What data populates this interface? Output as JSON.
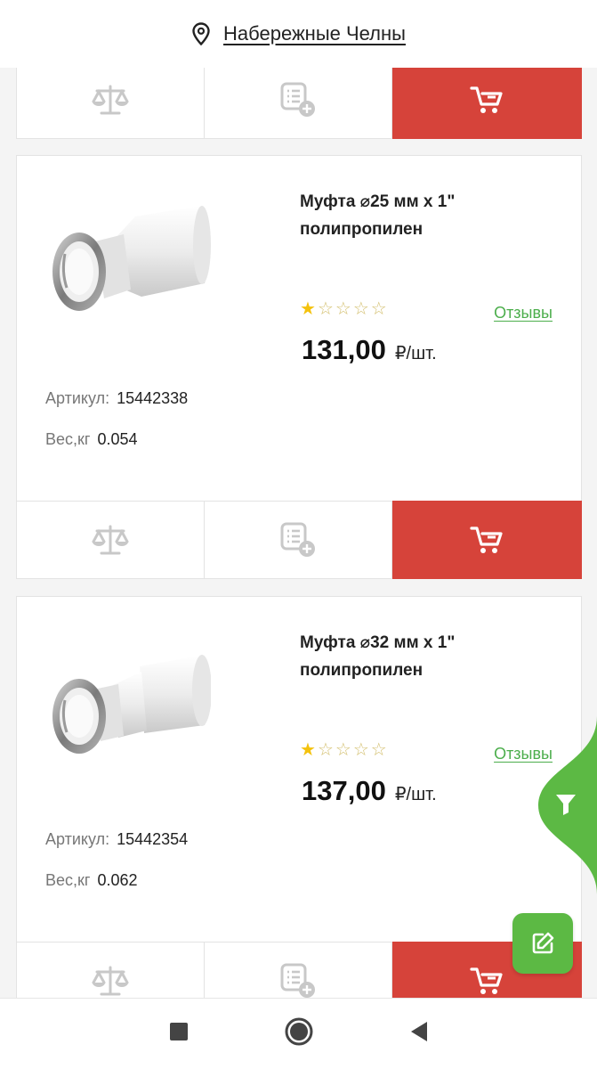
{
  "header": {
    "city": "Набережные Челны",
    "location_icon": "map-pin-icon"
  },
  "products": [
    {
      "title": "Муфта ⌀25 мм х 1\" полипропилен",
      "rating": 1,
      "rating_max": 5,
      "reviews_label": "Отзывы",
      "price": "131,00",
      "price_unit": "₽/шт.",
      "article_label": "Артикул:",
      "article": "15442338",
      "weight_label": "Вес,кг",
      "weight": "0.054"
    },
    {
      "title": "Муфта ⌀32 мм х 1\" полипропилен",
      "rating": 1,
      "rating_max": 5,
      "reviews_label": "Отзывы",
      "price": "137,00",
      "price_unit": "₽/шт.",
      "article_label": "Артикул:",
      "article": "15442354",
      "weight_label": "Вес,кг",
      "weight": "0.062"
    }
  ],
  "actions": {
    "compare_icon": "scales-icon",
    "list_icon": "add-to-list-icon",
    "cart_icon": "cart-icon"
  },
  "colors": {
    "cart": "#d6433a",
    "accent_green": "#5cb944",
    "link_green": "#4cae4c",
    "star": "#f4c20d"
  },
  "floating": {
    "filter_icon": "filter-icon",
    "edit_icon": "edit-icon"
  },
  "system_nav": {
    "recent": "square-icon",
    "home": "circle-icon",
    "back": "triangle-back-icon"
  }
}
